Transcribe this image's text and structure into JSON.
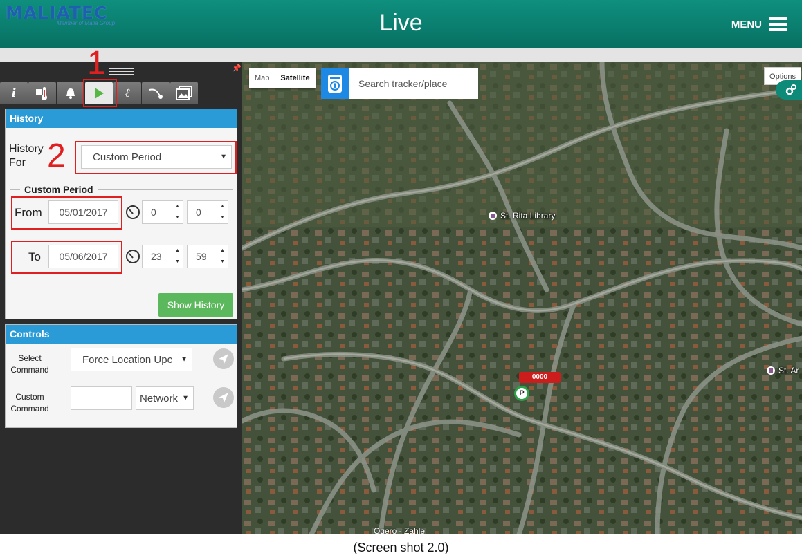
{
  "header": {
    "logo_text": "MALIATEC",
    "logo_subtext": "Member of Malia Group",
    "title": "Live",
    "menu_label": "MENU"
  },
  "colors": {
    "header_teal": "#0a7d6e",
    "section_blue": "#2a9bd6",
    "button_green": "#5cb85c",
    "annotation_red": "#e02020"
  },
  "tabs": [
    {
      "icon": "info-icon",
      "active": false
    },
    {
      "icon": "thermometer-icon",
      "active": false
    },
    {
      "icon": "bell-icon",
      "active": false
    },
    {
      "icon": "play-icon",
      "active": true
    },
    {
      "icon": "pen-icon",
      "active": false
    },
    {
      "icon": "route-icon",
      "active": false
    },
    {
      "icon": "image-gallery-icon",
      "active": false
    }
  ],
  "annotations": {
    "one": "1",
    "two": "2"
  },
  "history": {
    "heading": "History",
    "history_for_label": "History For",
    "history_for_value": "Custom Period",
    "custom_period_legend": "Custom Period",
    "from_label": "From",
    "from_date": "05/01/2017",
    "from_hour": "0",
    "from_minute": "0",
    "to_label": "To",
    "to_date": "05/06/2017",
    "to_hour": "23",
    "to_minute": "59",
    "show_history_label": "Show History"
  },
  "controls": {
    "heading": "Controls",
    "select_command_label_1": "Select",
    "select_command_label_2": "Command",
    "select_command_value": "Force Location Upc",
    "custom_command_label_1": "Custom",
    "custom_command_label_2": "Command",
    "custom_command_value": "",
    "network_value": "Network"
  },
  "map": {
    "type_map": "Map",
    "type_satellite": "Satellite",
    "selected_type": "Satellite",
    "search_placeholder": "Search tracker/place",
    "options_label": "Options",
    "poi_library": "St. Rita Library",
    "poi_right": "St. Ar",
    "marker_label": "0000",
    "marker_pin": "P",
    "attribution": "Ogero - Zahle"
  },
  "caption": "(Screen shot 2.0)"
}
